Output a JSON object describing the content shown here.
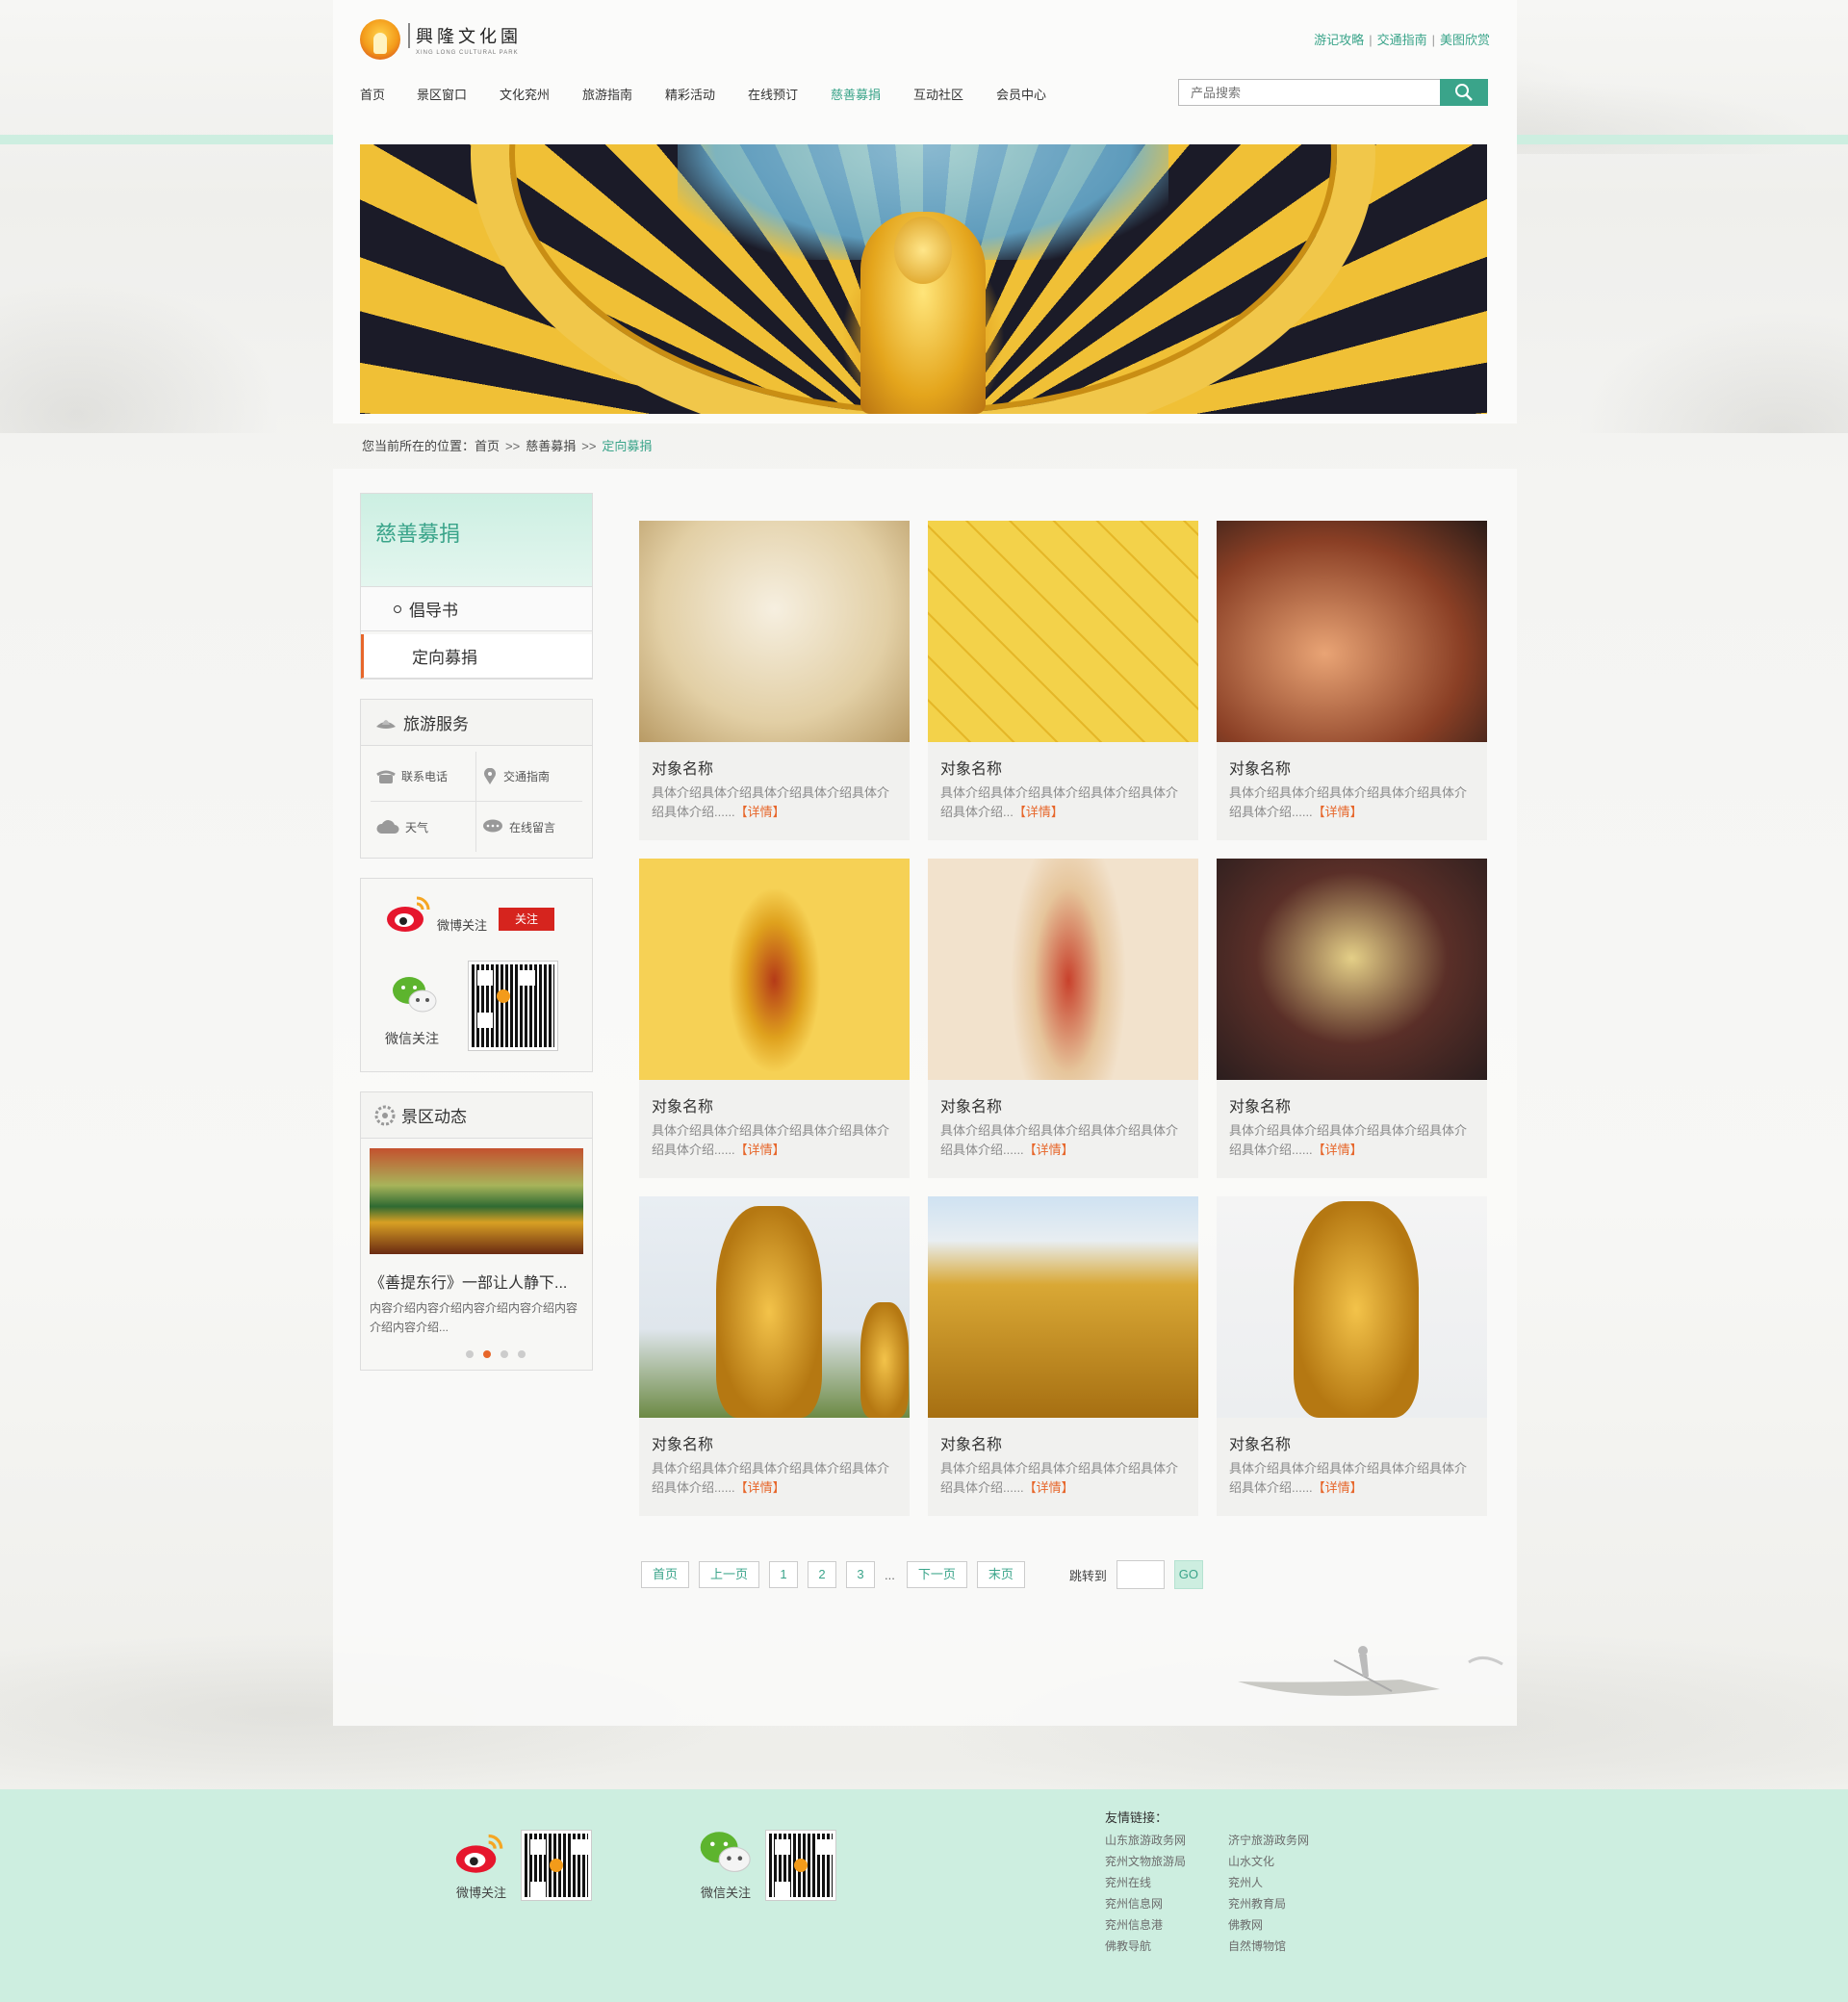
{
  "brand": {
    "logo_cn": "興隆文化園",
    "logo_en": "XING LONG CULTURAL PARK"
  },
  "toplinks": [
    "游记攻略",
    "交通指南",
    "美图欣赏"
  ],
  "nav": [
    "首页",
    "景区窗口",
    "文化兖州",
    "旅游指南",
    "精彩活动",
    "在线预订",
    "慈善募捐",
    "互动社区",
    "会员中心"
  ],
  "nav_active": "慈善募捐",
  "search": {
    "placeholder": "产品搜索"
  },
  "breadcrumb": {
    "prefix": "您当前所在的位置：",
    "home": "首页",
    "sep": ">>",
    "section": "慈善募捐",
    "current": "定向募捐"
  },
  "sidebar": {
    "title": "慈善募捐",
    "items": [
      "倡导书",
      "定向募捐"
    ],
    "current_item": "定向募捐",
    "service": {
      "title": "旅游服务",
      "items": [
        "联系电话",
        "交通指南",
        "天气",
        "在线留言"
      ]
    },
    "social": {
      "weibo": "微博关注",
      "follow": "关注",
      "wechat": "微信关注"
    },
    "news": {
      "title": "景区动态",
      "item_title": "《善提东行》一部让人静下...",
      "item_desc": "内容介绍内容介绍内容介绍内容介绍内容介绍内容介绍...",
      "slides": 4,
      "active_slide": 2
    }
  },
  "cards": [
    {
      "title": "对象名称",
      "desc": "具体介绍具体介绍具体介绍具体介绍具体介绍具体介绍......",
      "more": "【详情】"
    },
    {
      "title": "对象名称",
      "desc": "具体介绍具体介绍具体介绍具体介绍具体介绍具体介绍...",
      "more": "【详情】"
    },
    {
      "title": "对象名称",
      "desc": "具体介绍具体介绍具体介绍具体介绍具体介绍具体介绍......",
      "more": "【详情】"
    },
    {
      "title": "对象名称",
      "desc": "具体介绍具体介绍具体介绍具体介绍具体介绍具体介绍......",
      "more": "【详情】"
    },
    {
      "title": "对象名称",
      "desc": "具体介绍具体介绍具体介绍具体介绍具体介绍具体介绍......",
      "more": "【详情】"
    },
    {
      "title": "对象名称",
      "desc": "具体介绍具体介绍具体介绍具体介绍具体介绍具体介绍......",
      "more": "【详情】"
    },
    {
      "title": "对象名称",
      "desc": "具体介绍具体介绍具体介绍具体介绍具体介绍具体介绍......",
      "more": "【详情】"
    },
    {
      "title": "对象名称",
      "desc": "具体介绍具体介绍具体介绍具体介绍具体介绍具体介绍......",
      "more": "【详情】"
    },
    {
      "title": "对象名称",
      "desc": "具体介绍具体介绍具体介绍具体介绍具体介绍具体介绍......",
      "more": "【详情】"
    }
  ],
  "pager": {
    "first": "首页",
    "prev": "上一页",
    "pages": [
      "1",
      "2",
      "3"
    ],
    "ellipsis": "...",
    "next": "下一页",
    "last": "末页",
    "jump": "跳转到",
    "go": "GO"
  },
  "footer": {
    "weibo": "微博关注",
    "wechat": "微信关注",
    "links_title": "友情链接：",
    "links": [
      "山东旅游政务网",
      "济宁旅游政务网",
      "兖州文物旅游局",
      "山水文化",
      "兖州在线",
      "兖州人",
      "兖州信息网",
      "兖州教育局",
      "兖州信息港",
      "佛教网",
      "佛教导航",
      "自然博物馆"
    ]
  },
  "colors": {
    "accent": "#3aa48a",
    "orange": "#e7662a",
    "mint": "#cdeee0",
    "red": "#d6241e"
  }
}
